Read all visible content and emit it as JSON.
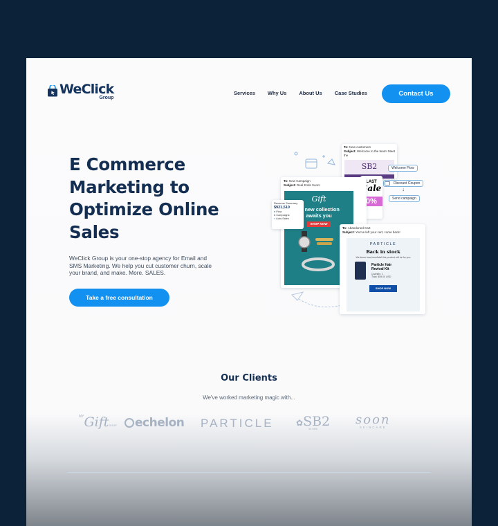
{
  "brand": {
    "name": "WeClick",
    "sub": "Group"
  },
  "nav": {
    "items": [
      "Services",
      "Why Us",
      "About Us",
      "Case Studies"
    ],
    "contact_label": "Contact Us"
  },
  "hero": {
    "title": "E Commerce Marketing to Optimize Online Sales",
    "description": "WeClick Group is your one-stop agency for Email and SMS Marketing. We help you cut customer churn, scale your brand, and make. More. SALES.",
    "cta_label": "Take a free consultation"
  },
  "collage": {
    "revenue": {
      "title": "Revenue Summary",
      "amount": "$921,510",
      "rows": [
        "Flow",
        "Campaigns",
        "Auto-Sales"
      ]
    },
    "new_campaign": {
      "to_label": "To:",
      "to": "New Campaign",
      "subject_label": "Subject:",
      "subject": "Deal Ends Soon!",
      "brand": "Gift",
      "headline": "ur new collection awaits you",
      "button": "SHOP NOW"
    },
    "welcome": {
      "to_label": "To:",
      "to": "New customers",
      "subject_label": "Subject:",
      "subject": "Welcome to the team! Meet the",
      "brand": "SB2"
    },
    "sale": {
      "top": "LAST",
      "word": "Sale",
      "pct": "0%"
    },
    "flow_steps": [
      "Welcome Flow",
      "Discount Coupon",
      "Send campaign"
    ],
    "abandoned": {
      "to_label": "To:",
      "to": "Abandoned Cart",
      "subject_label": "Subject:",
      "subject": "You've left your cart, come back!",
      "brand": "PARTICLE",
      "headline": "Back in stock",
      "tagline": "We know how beneficial this product will be for you",
      "product": "Particle Hair Revival Kit",
      "qty": "Quantity: 1",
      "total": "Total: $49.00 USD",
      "button": "SHOP NOW"
    }
  },
  "clients": {
    "title": "Our Clients",
    "subtitle": "We've worked marketing magic with...",
    "logos": [
      "Gift",
      "echelon",
      "PARTICLE",
      "SB2",
      "soon"
    ],
    "logo_small": {
      "gift_prefix": "MY",
      "gift_suffix": "SHOP",
      "sb2_sub": "W SPA",
      "soon_sub": "SKINCARE"
    }
  },
  "colors": {
    "accent": "#1391f1",
    "navy": "#142e52",
    "background": "#0b2239",
    "teal": "#1f7f86",
    "client_logo": "#a7b2c3"
  }
}
